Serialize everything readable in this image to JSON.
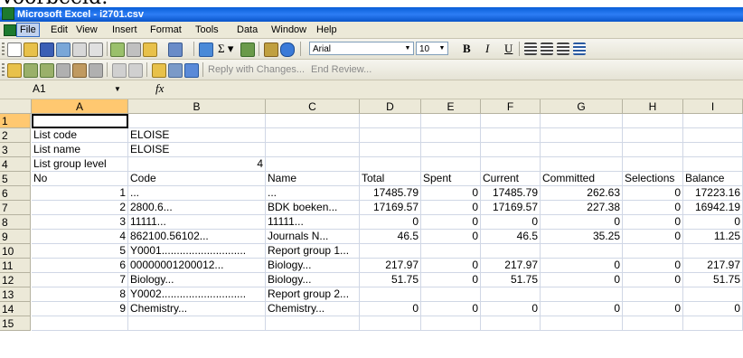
{
  "caption": "Voorbeeld:",
  "window": {
    "title": "Microsoft Excel - i2701.csv"
  },
  "menu": [
    "File",
    "Edit",
    "View",
    "Insert",
    "Format",
    "Tools",
    "Data",
    "Window",
    "Help"
  ],
  "toolbar": {
    "font_name": "Arial",
    "font_size": "10",
    "bold": "B",
    "italic": "I",
    "underline": "U",
    "reply_text": "Reply with Changes...",
    "end_review": "End Review..."
  },
  "formula": {
    "name_box": "A1",
    "fx": "fx",
    "content": ""
  },
  "columns": [
    "A",
    "B",
    "C",
    "D",
    "E",
    "F",
    "G",
    "H",
    "I"
  ],
  "rows": [
    [
      "",
      "",
      "",
      "",
      "",
      "",
      "",
      "",
      ""
    ],
    [
      "List code",
      "ELOISE",
      "",
      "",
      "",
      "",
      "",
      "",
      ""
    ],
    [
      "List name",
      "ELOISE",
      "",
      "",
      "",
      "",
      "",
      "",
      ""
    ],
    [
      "List group level",
      "4",
      "",
      "",
      "",
      "",
      "",
      "",
      ""
    ],
    [
      "No",
      "Code",
      "Name",
      "Total",
      "Spent",
      "Current",
      "Committed",
      "Selections",
      "Balance"
    ],
    [
      "1",
      "...",
      "...",
      "17485.79",
      "0",
      "17485.79",
      "262.63",
      "0",
      "17223.16"
    ],
    [
      "2",
      "2800.6...",
      "BDK boeken...",
      "17169.57",
      "0",
      "17169.57",
      "227.38",
      "0",
      "16942.19"
    ],
    [
      "3",
      "11111...",
      "11111...",
      "0",
      "0",
      "0",
      "0",
      "0",
      "0"
    ],
    [
      "4",
      "862100.56102...",
      "Journals N...",
      "46.5",
      "0",
      "46.5",
      "35.25",
      "0",
      "11.25"
    ],
    [
      "5",
      "Y0001............................",
      "Report group 1...",
      "",
      "",
      "",
      "",
      "",
      ""
    ],
    [
      "6",
      "   00000001200012...",
      "Biology...",
      "217.97",
      "0",
      "217.97",
      "0",
      "0",
      "217.97"
    ],
    [
      "7",
      "   Biology...",
      "Biology...",
      "51.75",
      "0",
      "51.75",
      "0",
      "0",
      "51.75"
    ],
    [
      "8",
      "Y0002............................",
      "Report group 2...",
      "",
      "",
      "",
      "",
      "",
      ""
    ],
    [
      "9",
      "   Chemistry...",
      "Chemistry...",
      "0",
      "0",
      "0",
      "0",
      "0",
      "0"
    ],
    [
      "",
      "",
      "",
      "",
      "",
      "",
      "",
      "",
      ""
    ]
  ],
  "row_numbers": [
    "1",
    "2",
    "3",
    "4",
    "5",
    "6",
    "7",
    "8",
    "9",
    "10",
    "11",
    "12",
    "13",
    "14",
    "15"
  ],
  "numeric_columns": [
    "D",
    "E",
    "F",
    "G",
    "H",
    "I"
  ]
}
